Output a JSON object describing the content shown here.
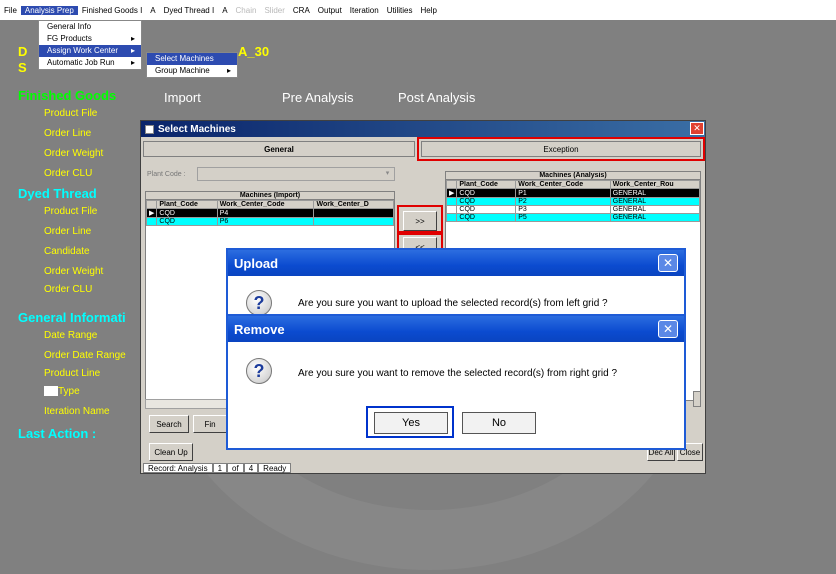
{
  "menubar": [
    "File",
    "Analysis Prep",
    "Finished Goods I",
    "A",
    "Dyed Thread I",
    "A",
    "Chain",
    "Slider",
    "CRA",
    "Output",
    "Iteration",
    "Utilities",
    "Help"
  ],
  "submenu1": [
    "General Info",
    "FG Products",
    "Assign Work Center",
    "Automatic Job Run"
  ],
  "submenu2": [
    "Select Machines",
    "Group Machine"
  ],
  "background": {
    "title_d": "D",
    "title_s": "S",
    "title_suffix": "A_30",
    "finished_goods": "Finished Goods",
    "fg_items": [
      "Product File",
      "Order Line",
      "Order Weight",
      "Order CLU"
    ],
    "dyed_thread": "Dyed Thread",
    "dt_items": [
      "Product File",
      "Order Line",
      "Candidate",
      "Order Weight",
      "Order CLU"
    ],
    "general_info": "General Informati",
    "gi_items": [
      "Date Range",
      "Order Date Range",
      "Product Line",
      "Type",
      "Iteration Name"
    ],
    "last_action": "Last Action :",
    "headers": [
      "Import",
      "Pre Analysis",
      "Post Analysis"
    ]
  },
  "window": {
    "title": "Select Machines",
    "tab_general": "General",
    "tab_exception": "Exception",
    "plant_code_label": "Plant Code :",
    "left_grid": {
      "caption": "Machines (Import)",
      "columns": [
        "Plant_Code",
        "Work_Center_Code",
        "Work_Center_D"
      ],
      "rows": [
        [
          "CQD",
          "P4",
          ""
        ],
        [
          "CQD",
          "P6",
          ""
        ]
      ]
    },
    "right_grid": {
      "caption": "Machines (Analysis)",
      "columns": [
        "Plant_Code",
        "Work_Center_Code",
        "Work_Center_Rou"
      ],
      "rows": [
        [
          "CQD",
          "P1",
          "GENERAL"
        ],
        [
          "CQD",
          "P2",
          "GENERAL"
        ],
        [
          "CQD",
          "P3",
          "GENERAL"
        ],
        [
          "CQD",
          "P5",
          "GENERAL"
        ]
      ]
    },
    "btn_right": ">>",
    "btn_left": "<<",
    "btn_search": "Search",
    "btn_find": "Fin",
    "btn_cleanup": "Clean Up",
    "btn_decall": "Dec All",
    "btn_close": "Close",
    "status": [
      "Record: Analysis",
      "1",
      "of",
      "4",
      "Ready"
    ]
  },
  "upload_dialog": {
    "title": "Upload",
    "message": "Are you sure you want to upload the selected record(s) from left grid ?"
  },
  "remove_dialog": {
    "title": "Remove",
    "message": "Are you sure you want to remove the selected record(s) from right grid ?",
    "yes": "Yes",
    "no": "No"
  }
}
